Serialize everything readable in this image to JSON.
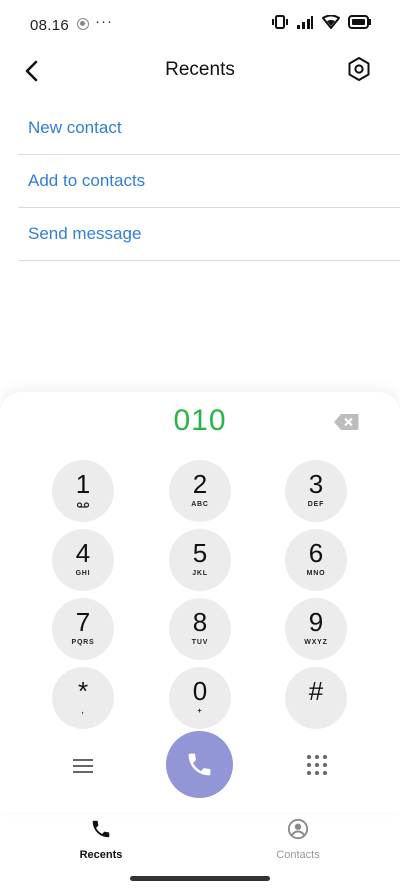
{
  "status_bar": {
    "time": "08.16",
    "more": "···"
  },
  "header": {
    "title": "Recents"
  },
  "actions": [
    {
      "label": "New contact"
    },
    {
      "label": "Add to contacts"
    },
    {
      "label": "Send message"
    }
  ],
  "dialer": {
    "number": "010",
    "number_color": "#28b446",
    "keys": [
      {
        "digit": "1",
        "letters": ""
      },
      {
        "digit": "2",
        "letters": "ABC"
      },
      {
        "digit": "3",
        "letters": "DEF"
      },
      {
        "digit": "4",
        "letters": "GHI"
      },
      {
        "digit": "5",
        "letters": "JKL"
      },
      {
        "digit": "6",
        "letters": "MNO"
      },
      {
        "digit": "7",
        "letters": "PQRS"
      },
      {
        "digit": "8",
        "letters": "TUV"
      },
      {
        "digit": "9",
        "letters": "WXYZ"
      },
      {
        "digit": "*",
        "letters": ","
      },
      {
        "digit": "0",
        "letters": "+"
      },
      {
        "digit": "#",
        "letters": ""
      }
    ],
    "call_button_color": "#9295d6"
  },
  "bottom_nav": {
    "recents_label": "Recents",
    "contacts_label": "Contacts"
  },
  "colors": {
    "link": "#2f7ed8",
    "key_bg": "#ececec"
  }
}
